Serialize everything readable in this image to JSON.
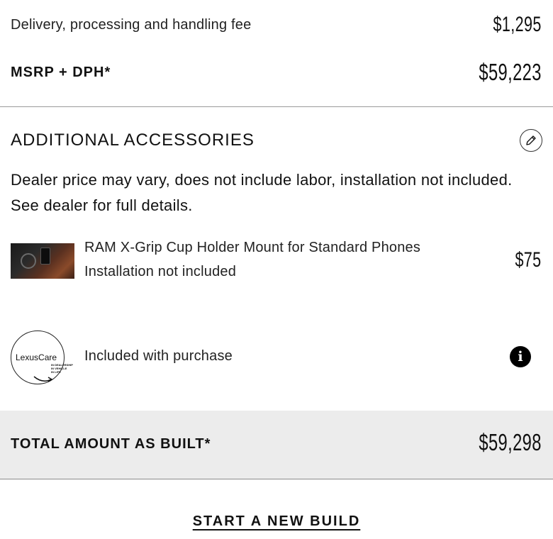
{
  "summary": {
    "fee_label": "Delivery, processing and handling fee",
    "fee_price": "$1,295",
    "msrp_label": "MSRP + DPH*",
    "msrp_price": "$59,223"
  },
  "accessories": {
    "title": "ADDITIONAL ACCESSORIES",
    "edit_icon": "pencil-icon",
    "note": "Dealer price may vary, does not include labor, installation not included. See dealer for full details.",
    "items": [
      {
        "name": "RAM X-Grip Cup Holder Mount for Standard Phones",
        "subtext": "Installation not included",
        "price": "$75",
        "image": "product-thumbnail"
      }
    ]
  },
  "lexus_care": {
    "logo_text": "LexusCare",
    "logo_small_lines": [
      "IN DEALERSHIP",
      "IN VEHICLE",
      "IN LIFE"
    ],
    "text": "Included with purchase",
    "info_icon": "info-icon"
  },
  "total": {
    "label": "TOTAL AMOUNT AS BUILT*",
    "price": "$59,298"
  },
  "actions": {
    "new_build_label": "START A NEW BUILD"
  },
  "colors": {
    "text": "#111111",
    "band": "#ececec",
    "divider": "#9a9a9a"
  }
}
